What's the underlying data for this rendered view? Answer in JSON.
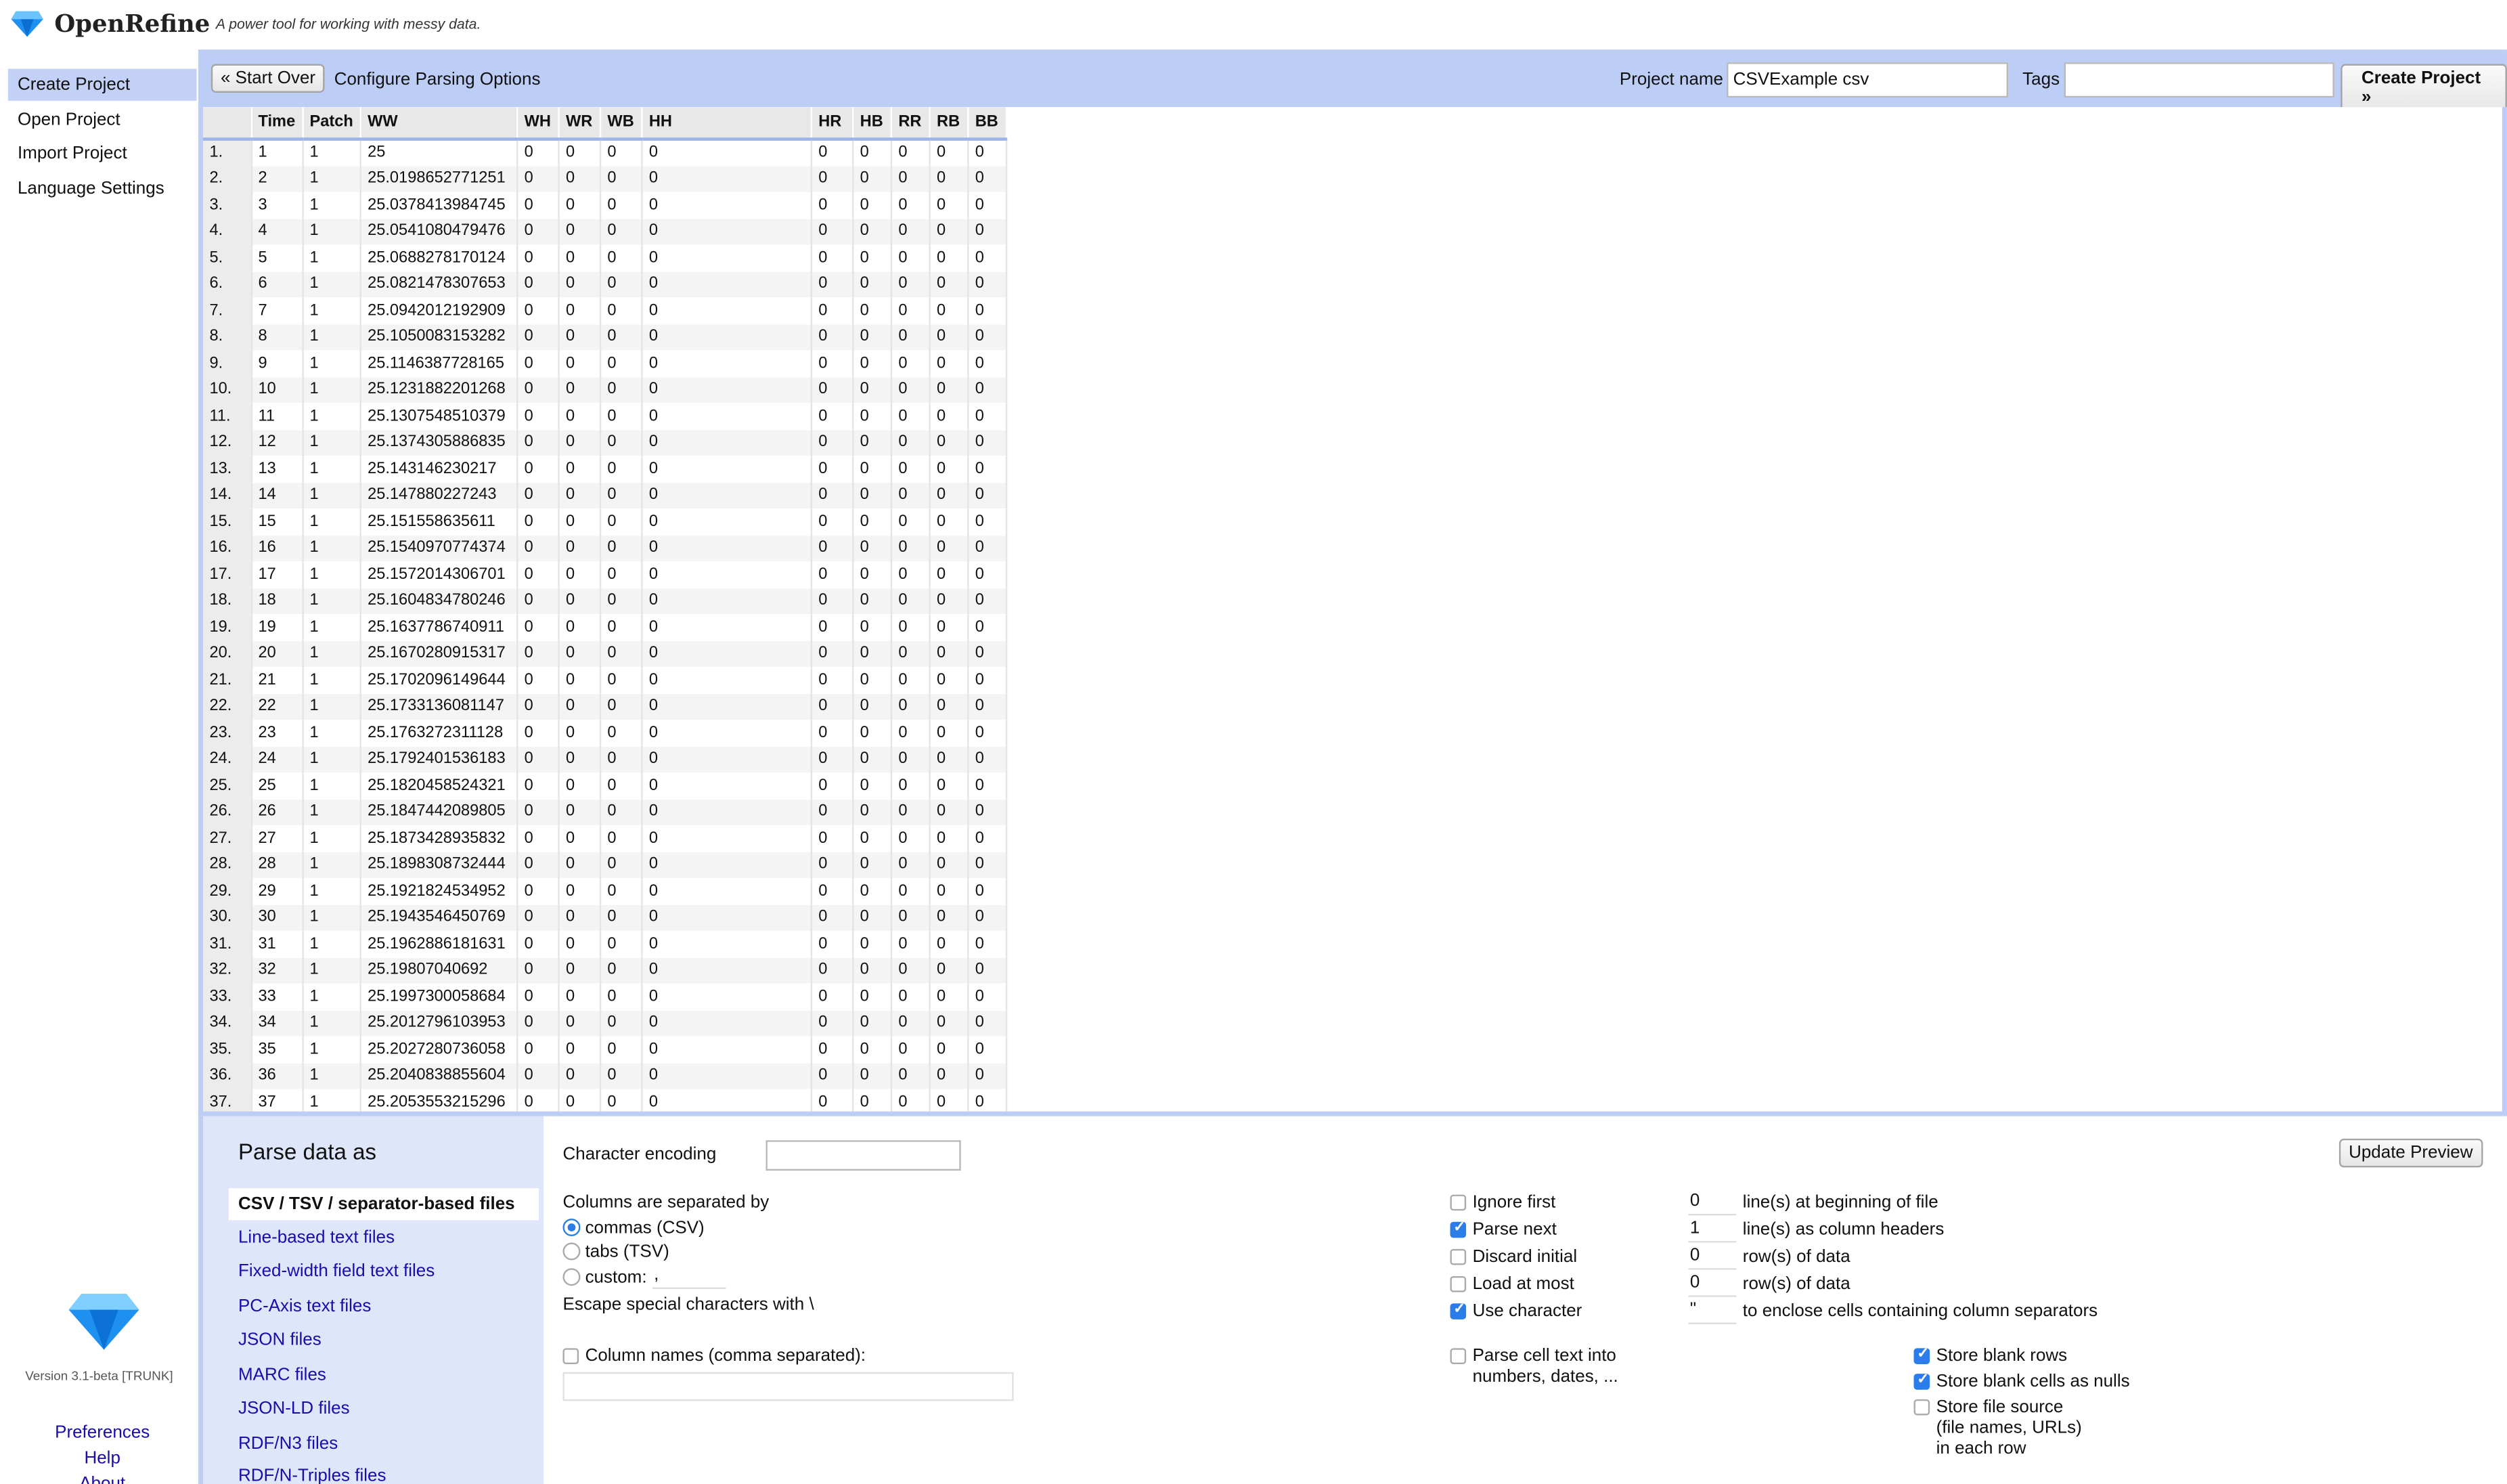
{
  "header": {
    "brand": "OpenRefine",
    "tagline": "A power tool for working with messy data."
  },
  "nav": {
    "items": [
      "Create Project",
      "Open Project",
      "Import Project",
      "Language Settings"
    ],
    "version": "Version 3.1-beta [TRUNK]",
    "links": [
      "Preferences",
      "Help",
      "About"
    ]
  },
  "toolbar": {
    "start_over": "« Start Over",
    "title": "Configure Parsing Options",
    "project_name_label": "Project name",
    "project_name_value": "CSVExample csv",
    "tags_label": "Tags",
    "tags_value": "",
    "create_button": "Create Project »"
  },
  "grid": {
    "columns": [
      "Time",
      "Patch",
      "WW",
      "WH",
      "WR",
      "WB",
      "HH",
      "HR",
      "HB",
      "RR",
      "RB",
      "BB"
    ],
    "ww_values": [
      "25",
      "25.0198652771251",
      "25.0378413984745",
      "25.0541080479476",
      "25.0688278170124",
      "25.0821478307653",
      "25.0942012192909",
      "25.1050083153282",
      "25.1146387728165",
      "25.1231882201268",
      "25.1307548510379",
      "25.1374305886835",
      "25.143146230217",
      "25.147880227243",
      "25.151558635611",
      "25.1540970774374",
      "25.1572014306701",
      "25.1604834780246",
      "25.1637786740911",
      "25.1670280915317",
      "25.1702096149644",
      "25.1733136081147",
      "25.1763272311128",
      "25.1792401536183",
      "25.1820458524321",
      "25.1847442089805",
      "25.1873428935832",
      "25.1898308732444",
      "25.1921824534952",
      "25.1943546450769",
      "25.1962886181631",
      "25.19807040692",
      "25.1997300058684",
      "25.2012796103953",
      "25.2027280736058",
      "25.2040838855604",
      "25.2053553215296"
    ],
    "patch_value": "1",
    "zero": "0"
  },
  "parse": {
    "title": "Parse data as",
    "formats": [
      "CSV / TSV / separator-based files",
      "Line-based text files",
      "Fixed-width field text files",
      "PC-Axis text files",
      "JSON files",
      "MARC files",
      "JSON-LD files",
      "RDF/N3 files",
      "RDF/N-Triples files"
    ]
  },
  "options": {
    "encoding_label": "Character encoding",
    "encoding_value": "",
    "update_preview": "Update Preview",
    "separated_by": "Columns are separated by",
    "sep_commas": "commas (CSV)",
    "sep_tabs": "tabs (TSV)",
    "sep_custom": "custom:",
    "sep_custom_value": ",",
    "escape_label": "Escape special characters with \\",
    "column_names_label": "Column names (comma separated):",
    "ignore_first": "Ignore first",
    "ignore_first_value": "0",
    "ignore_first_suffix": "line(s) at beginning of file",
    "parse_next": "Parse next",
    "parse_next_value": "1",
    "parse_next_suffix": "line(s) as column headers",
    "discard_initial": "Discard initial",
    "discard_initial_value": "0",
    "discard_initial_suffix": "row(s) of data",
    "load_at_most": "Load at most",
    "load_at_most_value": "0",
    "load_at_most_suffix": "row(s) of data",
    "use_character": "Use character",
    "use_character_value": "\"",
    "use_character_suffix": "to enclose cells containing column separators",
    "parse_cell_text_1": "Parse cell text into",
    "parse_cell_text_2": "numbers, dates, ...",
    "store_blank_rows": "Store blank rows",
    "store_blank_cells": "Store blank cells as nulls",
    "store_file_source_1": "Store file source",
    "store_file_source_2": "(file names, URLs)",
    "store_file_source_3": "in each row"
  },
  "colors": {
    "accent": "#bccdf6",
    "link": "#1a0dab",
    "checkbox": "#2b7de9"
  }
}
